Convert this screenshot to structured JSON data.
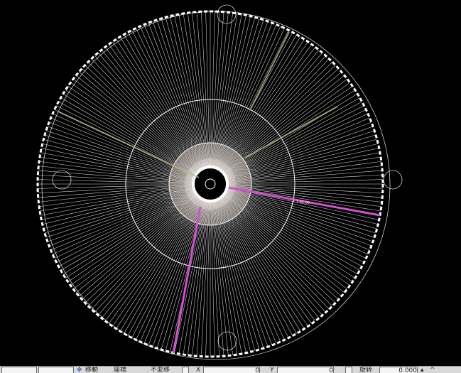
{
  "colors": {
    "background": "#000000",
    "geometry": "#ffffff",
    "hub_fill": "#a08c80",
    "highlight_magenta": "#d24fd2",
    "highlight_khaki": "#b9b38a",
    "statusbar": "#d8d8d8"
  },
  "drawing": {
    "spoke_count": 240,
    "dimension_text": "1 1,62.00"
  },
  "status_bar": {
    "snap_mode": "",
    "combo_value": "",
    "move_label": "移動",
    "coord_label": "座標",
    "no_change_label": "不変移",
    "x_label": "X",
    "x_value": "0",
    "y_label": "Y",
    "y_value": "0",
    "rotate_label": "旋转",
    "rotate_value": "0.000"
  }
}
